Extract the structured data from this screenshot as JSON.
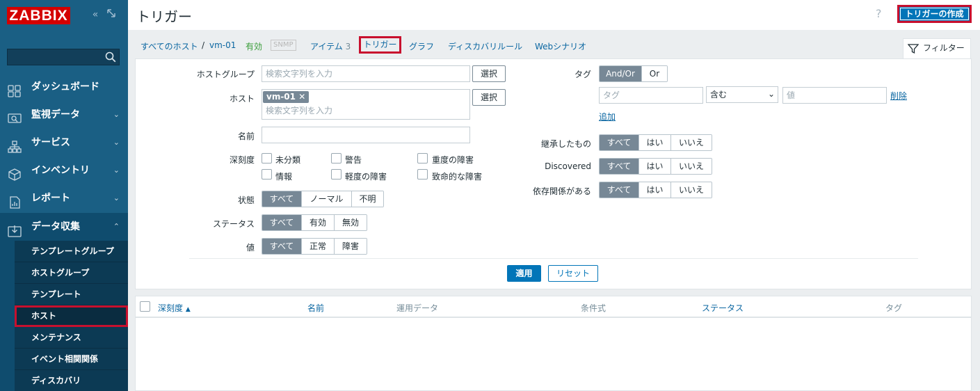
{
  "sidebar": {
    "logo": "ZABBIX",
    "collapse_icon": "«",
    "expand_icon": "⤢",
    "search_placeholder": "",
    "menu": [
      {
        "label": "ダッシュボード",
        "icon": "dashboard-icon"
      },
      {
        "label": "監視データ",
        "icon": "monitoring-icon"
      },
      {
        "label": "サービス",
        "icon": "services-icon"
      },
      {
        "label": "インベントリ",
        "icon": "inventory-icon"
      },
      {
        "label": "レポート",
        "icon": "reports-icon"
      },
      {
        "label": "データ収集",
        "icon": "data-collection-icon"
      }
    ],
    "submenu": [
      "テンプレートグループ",
      "ホストグループ",
      "テンプレート",
      "ホスト",
      "メンテナンス",
      "イベント相関関係",
      "ディスカバリ"
    ]
  },
  "header": {
    "title": "トリガー",
    "help": "?",
    "create_button": "トリガーの作成"
  },
  "nav": {
    "all_hosts": "すべてのホスト",
    "sep": "/",
    "host": "vm-01",
    "enabled": "有効",
    "snmp": "SNMP",
    "items": "アイテム",
    "items_count": "3",
    "triggers": "トリガー",
    "graphs": "グラフ",
    "discovery": "ディスカバリルール",
    "web": "Webシナリオ"
  },
  "filter": {
    "tab_label": "フィルター",
    "host_group_label": "ホストグループ",
    "host_group_placeholder": "検索文字列を入力",
    "select_button": "選択",
    "host_label": "ホスト",
    "host_chip": "vm-01",
    "host_placeholder": "検索文字列を入力",
    "name_label": "名前",
    "severity_label": "深刻度",
    "severities": [
      "未分類",
      "警告",
      "重度の障害",
      "情報",
      "軽度の障害",
      "致命的な障害"
    ],
    "state_label": "状態",
    "state_options": [
      "すべて",
      "ノーマル",
      "不明"
    ],
    "status_label": "ステータス",
    "status_options": [
      "すべて",
      "有効",
      "無効"
    ],
    "value_label": "値",
    "value_options": [
      "すべて",
      "正常",
      "障害"
    ],
    "tags_label": "タグ",
    "tags_eval": [
      "And/Or",
      "Or"
    ],
    "tag_placeholder": "タグ",
    "tag_operator": "含む",
    "tag_value_placeholder": "値",
    "tag_remove": "削除",
    "tag_add": "追加",
    "inherited_label": "継承したもの",
    "discovered_label": "Discovered",
    "dependencies_label": "依存関係がある",
    "tri_options": [
      "すべて",
      "はい",
      "いいえ"
    ],
    "apply": "適用",
    "reset": "リセット"
  },
  "table": {
    "columns": [
      "深刻度",
      "名前",
      "運用データ",
      "条件式",
      "ステータス",
      "タグ"
    ],
    "sort_arrow": "▲"
  }
}
